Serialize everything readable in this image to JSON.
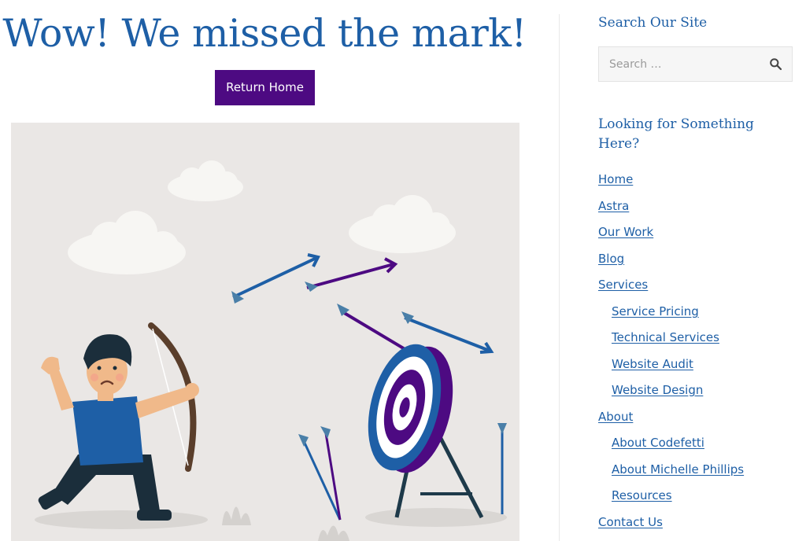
{
  "main": {
    "heading": "Wow! We missed the mark!",
    "return_button": "Return Home"
  },
  "sidebar": {
    "search": {
      "title": "Search Our Site",
      "placeholder": "Search …"
    },
    "nav": {
      "title": "Looking for Something Here?",
      "items": [
        {
          "label": "Home",
          "level": 1
        },
        {
          "label": "Astra",
          "level": 1
        },
        {
          "label": "Our Work",
          "level": 1
        },
        {
          "label": "Blog",
          "level": 1
        },
        {
          "label": "Services",
          "level": 1
        },
        {
          "label": "Service Pricing",
          "level": 2
        },
        {
          "label": "Technical Services",
          "level": 2
        },
        {
          "label": "Website Audit",
          "level": 2
        },
        {
          "label": "Website Design",
          "level": 2
        },
        {
          "label": "About",
          "level": 1
        },
        {
          "label": "About Codefetti",
          "level": 2
        },
        {
          "label": "About Michelle Phillips",
          "level": 2
        },
        {
          "label": "Resources",
          "level": 2
        },
        {
          "label": "Contact Us",
          "level": 1
        }
      ]
    }
  },
  "colors": {
    "heading": "#1e5fa6",
    "button_bg": "#4d0a82",
    "link": "#1e5fa6",
    "illustration_bg": "#eae7e5"
  },
  "icons": {
    "search": "search-icon"
  }
}
